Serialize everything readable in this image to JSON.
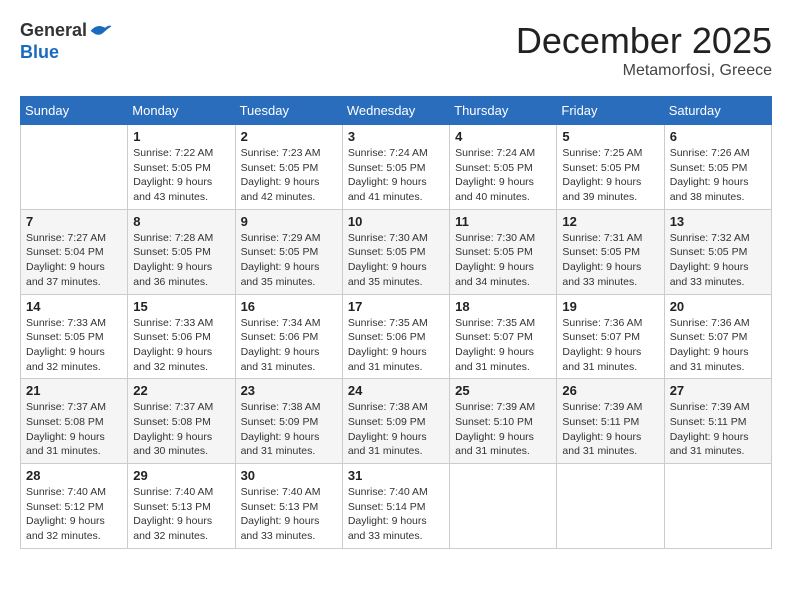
{
  "header": {
    "logo_line1": "General",
    "logo_line2": "Blue",
    "month_title": "December 2025",
    "location": "Metamorfosi, Greece"
  },
  "weekdays": [
    "Sunday",
    "Monday",
    "Tuesday",
    "Wednesday",
    "Thursday",
    "Friday",
    "Saturday"
  ],
  "weeks": [
    [
      {
        "day": "",
        "info": ""
      },
      {
        "day": "1",
        "info": "Sunrise: 7:22 AM\nSunset: 5:05 PM\nDaylight: 9 hours\nand 43 minutes."
      },
      {
        "day": "2",
        "info": "Sunrise: 7:23 AM\nSunset: 5:05 PM\nDaylight: 9 hours\nand 42 minutes."
      },
      {
        "day": "3",
        "info": "Sunrise: 7:24 AM\nSunset: 5:05 PM\nDaylight: 9 hours\nand 41 minutes."
      },
      {
        "day": "4",
        "info": "Sunrise: 7:24 AM\nSunset: 5:05 PM\nDaylight: 9 hours\nand 40 minutes."
      },
      {
        "day": "5",
        "info": "Sunrise: 7:25 AM\nSunset: 5:05 PM\nDaylight: 9 hours\nand 39 minutes."
      },
      {
        "day": "6",
        "info": "Sunrise: 7:26 AM\nSunset: 5:05 PM\nDaylight: 9 hours\nand 38 minutes."
      }
    ],
    [
      {
        "day": "7",
        "info": "Sunrise: 7:27 AM\nSunset: 5:04 PM\nDaylight: 9 hours\nand 37 minutes."
      },
      {
        "day": "8",
        "info": "Sunrise: 7:28 AM\nSunset: 5:05 PM\nDaylight: 9 hours\nand 36 minutes."
      },
      {
        "day": "9",
        "info": "Sunrise: 7:29 AM\nSunset: 5:05 PM\nDaylight: 9 hours\nand 35 minutes."
      },
      {
        "day": "10",
        "info": "Sunrise: 7:30 AM\nSunset: 5:05 PM\nDaylight: 9 hours\nand 35 minutes."
      },
      {
        "day": "11",
        "info": "Sunrise: 7:30 AM\nSunset: 5:05 PM\nDaylight: 9 hours\nand 34 minutes."
      },
      {
        "day": "12",
        "info": "Sunrise: 7:31 AM\nSunset: 5:05 PM\nDaylight: 9 hours\nand 33 minutes."
      },
      {
        "day": "13",
        "info": "Sunrise: 7:32 AM\nSunset: 5:05 PM\nDaylight: 9 hours\nand 33 minutes."
      }
    ],
    [
      {
        "day": "14",
        "info": "Sunrise: 7:33 AM\nSunset: 5:05 PM\nDaylight: 9 hours\nand 32 minutes."
      },
      {
        "day": "15",
        "info": "Sunrise: 7:33 AM\nSunset: 5:06 PM\nDaylight: 9 hours\nand 32 minutes."
      },
      {
        "day": "16",
        "info": "Sunrise: 7:34 AM\nSunset: 5:06 PM\nDaylight: 9 hours\nand 31 minutes."
      },
      {
        "day": "17",
        "info": "Sunrise: 7:35 AM\nSunset: 5:06 PM\nDaylight: 9 hours\nand 31 minutes."
      },
      {
        "day": "18",
        "info": "Sunrise: 7:35 AM\nSunset: 5:07 PM\nDaylight: 9 hours\nand 31 minutes."
      },
      {
        "day": "19",
        "info": "Sunrise: 7:36 AM\nSunset: 5:07 PM\nDaylight: 9 hours\nand 31 minutes."
      },
      {
        "day": "20",
        "info": "Sunrise: 7:36 AM\nSunset: 5:07 PM\nDaylight: 9 hours\nand 31 minutes."
      }
    ],
    [
      {
        "day": "21",
        "info": "Sunrise: 7:37 AM\nSunset: 5:08 PM\nDaylight: 9 hours\nand 31 minutes."
      },
      {
        "day": "22",
        "info": "Sunrise: 7:37 AM\nSunset: 5:08 PM\nDaylight: 9 hours\nand 30 minutes."
      },
      {
        "day": "23",
        "info": "Sunrise: 7:38 AM\nSunset: 5:09 PM\nDaylight: 9 hours\nand 31 minutes."
      },
      {
        "day": "24",
        "info": "Sunrise: 7:38 AM\nSunset: 5:09 PM\nDaylight: 9 hours\nand 31 minutes."
      },
      {
        "day": "25",
        "info": "Sunrise: 7:39 AM\nSunset: 5:10 PM\nDaylight: 9 hours\nand 31 minutes."
      },
      {
        "day": "26",
        "info": "Sunrise: 7:39 AM\nSunset: 5:11 PM\nDaylight: 9 hours\nand 31 minutes."
      },
      {
        "day": "27",
        "info": "Sunrise: 7:39 AM\nSunset: 5:11 PM\nDaylight: 9 hours\nand 31 minutes."
      }
    ],
    [
      {
        "day": "28",
        "info": "Sunrise: 7:40 AM\nSunset: 5:12 PM\nDaylight: 9 hours\nand 32 minutes."
      },
      {
        "day": "29",
        "info": "Sunrise: 7:40 AM\nSunset: 5:13 PM\nDaylight: 9 hours\nand 32 minutes."
      },
      {
        "day": "30",
        "info": "Sunrise: 7:40 AM\nSunset: 5:13 PM\nDaylight: 9 hours\nand 33 minutes."
      },
      {
        "day": "31",
        "info": "Sunrise: 7:40 AM\nSunset: 5:14 PM\nDaylight: 9 hours\nand 33 minutes."
      },
      {
        "day": "",
        "info": ""
      },
      {
        "day": "",
        "info": ""
      },
      {
        "day": "",
        "info": ""
      }
    ]
  ]
}
